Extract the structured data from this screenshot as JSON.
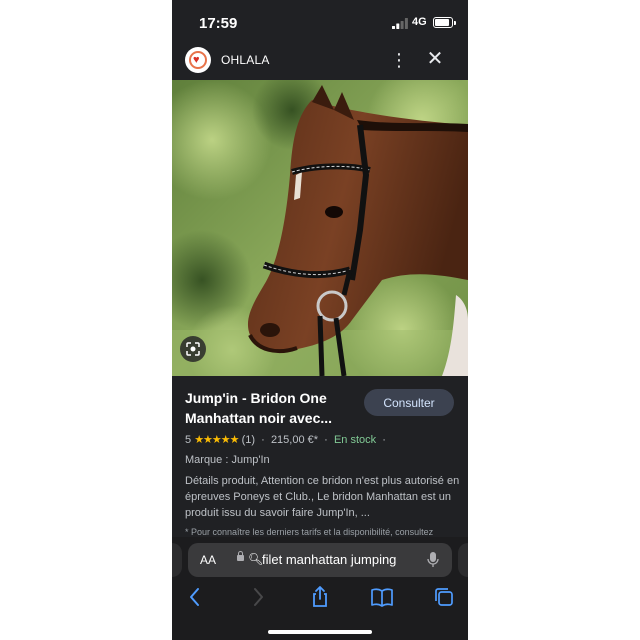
{
  "status_bar": {
    "time": "17:59",
    "network": "4G",
    "battery_level": 0.85
  },
  "site": {
    "name": "OHLALA",
    "logo_icon": "heart-logo-icon"
  },
  "product": {
    "title": "Jump'in - Bridon One Manhattan noir avec...",
    "consult_label": "Consulter",
    "rating_value": "5",
    "rating_stars": "★★★★★",
    "review_count": "(1)",
    "separator": "·",
    "price": "215,00 €*",
    "availability": "En stock",
    "brand": "Marque : Jump'In",
    "description": "Détails produit, Attention ce bridon n'est plus autorisé en épreuves Poneys et Club., Le bridon Manhattan est un produit issu du savoir faire Jump'In, ...",
    "footnote": "* Pour connaître les derniers tarifs et la disponibilité, consultez"
  },
  "browser": {
    "text_size_label": "AA",
    "address_text": "filet manhattan jumping",
    "toolbar_icons": [
      "back-icon",
      "forward-icon",
      "share-icon",
      "bookmarks-icon",
      "tabs-icon"
    ]
  },
  "colors": {
    "background": "#202124",
    "accent_link": "#4f9cff",
    "stock_green": "#81c995",
    "star_yellow": "#fbbc04",
    "button_bg": "#3c4250"
  }
}
